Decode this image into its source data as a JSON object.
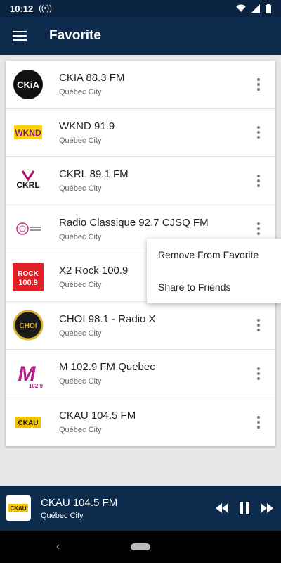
{
  "status_bar": {
    "time": "10:12"
  },
  "app_bar": {
    "title": "Favorite",
    "menu_icon": "hamburger-menu-icon"
  },
  "stations": [
    {
      "name": "CKIA 88.3 FM",
      "city": "Québec City",
      "logo_text": "CKiA",
      "logo_bg": "#111111",
      "logo_fg": "#ffffff"
    },
    {
      "name": "WKND 91.9",
      "city": "Québec City",
      "logo_text": "WKND",
      "logo_bg": "#ffd400",
      "logo_fg": "#7a1a7a"
    },
    {
      "name": "CKRL 89.1 FM",
      "city": "Québec City",
      "logo_text": "CKRL",
      "logo_bg": "#ffffff",
      "logo_fg": "#b0136e"
    },
    {
      "name": "Radio Classique 92.7 CJSQ FM",
      "city": "Québec City",
      "logo_text": "",
      "logo_bg": "#ffffff",
      "logo_fg": "#c0307a"
    },
    {
      "name": "X2 Rock 100.9",
      "city": "Québec City",
      "logo_text": "ROCK 100.9",
      "logo_bg": "#e01f26",
      "logo_fg": "#ffffff"
    },
    {
      "name": "CHOI 98.1 - Radio X",
      "city": "Québec City",
      "logo_text": "CHOI",
      "logo_bg": "#1a1a1a",
      "logo_fg": "#d9b230"
    },
    {
      "name": "M 102.9 FM Quebec",
      "city": "Québec City",
      "logo_text": "M",
      "logo_bg": "#ffffff",
      "logo_fg": "#b4208a"
    },
    {
      "name": "CKAU 104.5 FM",
      "city": "Québec City",
      "logo_text": "CKAU",
      "logo_bg": "#ffffff",
      "logo_fg": "#1b1b1b"
    }
  ],
  "popup_menu": {
    "remove": "Remove From Favorite",
    "share": "Share to Friends"
  },
  "player": {
    "name": "CKAU 104.5 FM",
    "city": "Québec City",
    "logo_text": "CKAU"
  },
  "colors": {
    "primary": "#0d2b4d",
    "status": "#0a2340"
  }
}
